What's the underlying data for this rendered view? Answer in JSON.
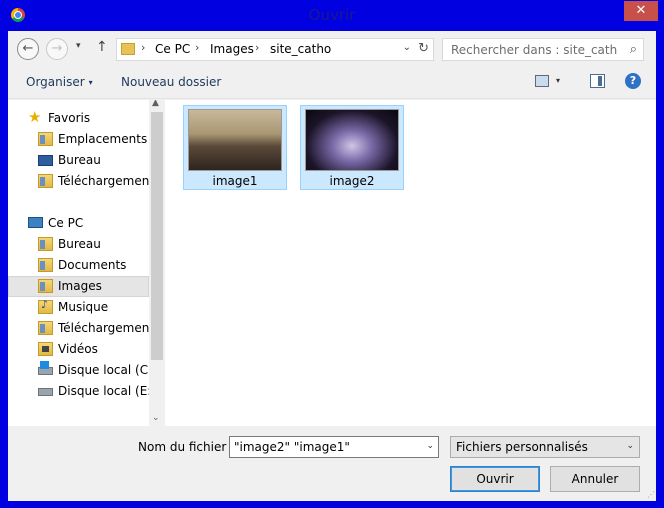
{
  "window": {
    "title": "Ouvrir",
    "close_label": "✕"
  },
  "address": {
    "back_icon": "←",
    "forward_icon": "→",
    "recent_icon": "▾",
    "up_icon": "↑",
    "crumbs": [
      "Ce PC",
      "Images",
      "site_catho"
    ],
    "separator": "›",
    "dropdown_icon": "⌄",
    "refresh_icon": "↻"
  },
  "search": {
    "placeholder": "Rechercher dans : site_catho",
    "icon": "⌕"
  },
  "toolbar": {
    "organize_label": "Organiser",
    "organize_caret": "▾",
    "new_folder_label": "Nouveau dossier",
    "view_caret": "▾",
    "help_label": "?"
  },
  "sidebar": {
    "favorites": {
      "label": "Favoris",
      "icon": "★",
      "items": [
        {
          "label": "Emplacements récents",
          "icon": "recent-places-icon"
        },
        {
          "label": "Bureau",
          "icon": "desktop-icon"
        },
        {
          "label": "Téléchargements",
          "icon": "downloads-icon"
        }
      ]
    },
    "this_pc": {
      "label": "Ce PC",
      "items": [
        {
          "label": "Bureau",
          "icon": "desktop-folder-icon"
        },
        {
          "label": "Documents",
          "icon": "documents-icon"
        },
        {
          "label": "Images",
          "icon": "pictures-icon",
          "selected": true
        },
        {
          "label": "Musique",
          "icon": "music-icon"
        },
        {
          "label": "Téléchargements",
          "icon": "downloads-icon"
        },
        {
          "label": "Vidéos",
          "icon": "videos-icon"
        },
        {
          "label": "Disque local (C:)",
          "icon": "windows-drive-icon"
        },
        {
          "label": "Disque local (E:)",
          "icon": "drive-icon"
        }
      ]
    },
    "scroll_up": "▲",
    "scroll_down": "⌄"
  },
  "files": [
    {
      "name": "image1",
      "thumbnail": "church-interior-concert",
      "selected": true
    },
    {
      "name": "image2",
      "thumbnail": "illuminated-building-night",
      "selected": true
    }
  ],
  "footer": {
    "filename_label": "Nom du fichier :",
    "filename_value": "\"image2\" \"image1\"",
    "filename_dropdown": "⌄",
    "filetype_label": "Fichiers personnalisés",
    "filetype_dropdown": "⌄",
    "open_label": "Ouvrir",
    "cancel_label": "Annuler",
    "grip": "⋰"
  },
  "colors": {
    "title_bar": "#0000e0",
    "close_button": "#c7504b",
    "selection": "#cce8ff",
    "selection_border": "#99d1ff"
  }
}
